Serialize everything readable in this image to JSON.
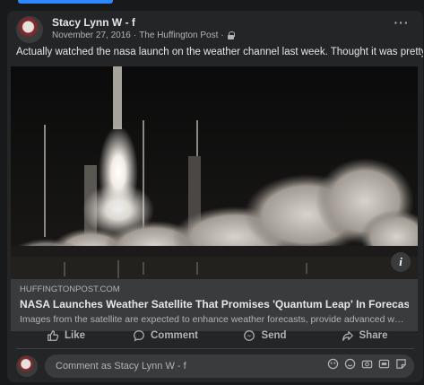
{
  "post": {
    "author": "Stacy Lynn W - f",
    "date": "November 27, 2016",
    "separator": "·",
    "source": "The Huffington Post",
    "separator2": "·",
    "message": "Actually watched the nasa launch on the weather channel last week.  Thought it was pretty cool."
  },
  "link": {
    "domain": "HUFFINGTONPOST.COM",
    "title": "NASA Launches Weather Satellite That Promises 'Quantum Leap' In Forecasts",
    "description": "Images from the satellite are expected to enhance weather forecasts, provide advanced warnin..."
  },
  "actions": {
    "like": "Like",
    "comment": "Comment",
    "send": "Send",
    "share": "Share"
  },
  "comment_box": {
    "placeholder": "Comment as Stacy Lynn W - f"
  },
  "icons": {
    "more": "more-options-icon",
    "privacy": "lock-icon",
    "info": "info-icon"
  },
  "colors": {
    "background": "#18191a",
    "card": "#242526",
    "accent": "#2d88ff"
  }
}
